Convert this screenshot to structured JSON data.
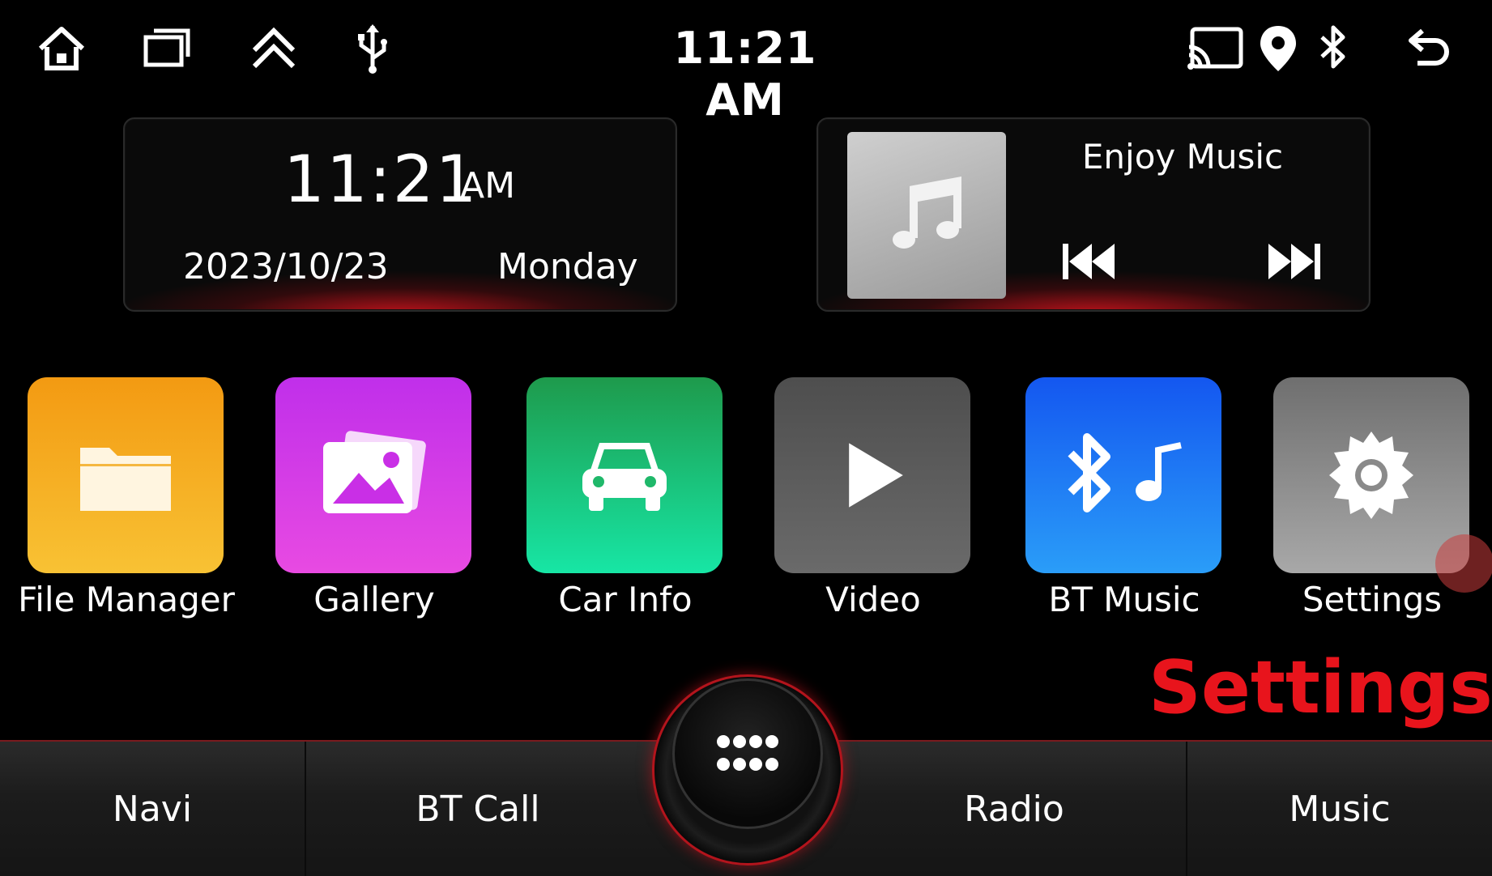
{
  "status_bar": {
    "time": "11:21 AM",
    "left_icons": [
      "home-icon",
      "recent-apps-icon",
      "double-chevron-up-icon",
      "usb-icon"
    ],
    "right_icons": [
      "cast-icon",
      "location-pin-icon",
      "bluetooth-icon",
      "back-icon"
    ]
  },
  "clock_widget": {
    "time": "11:21",
    "ampm": "AM",
    "date": "2023/10/23",
    "day": "Monday"
  },
  "music_widget": {
    "title": "Enjoy Music",
    "album_icon": "music-note-icon",
    "controls": [
      "previous-icon",
      "next-icon"
    ]
  },
  "apps": [
    {
      "label": "File Manager",
      "icon": "folder-icon",
      "color": "#f5a623"
    },
    {
      "label": "Gallery",
      "icon": "gallery-icon",
      "color": "#d52ee8"
    },
    {
      "label": "Car Info",
      "icon": "car-icon",
      "color": "#1fb86a"
    },
    {
      "label": "Video",
      "icon": "play-icon",
      "color": "#5a5a5a"
    },
    {
      "label": "BT Music",
      "icon": "bluetooth-music-icon",
      "color": "#1a6cf5"
    },
    {
      "label": "Settings",
      "icon": "gear-icon",
      "color": "#8a8a8a"
    }
  ],
  "overlay_caption": "Settings",
  "dock": {
    "items": [
      "Navi",
      "BT Call",
      "Radio",
      "Music"
    ],
    "center_icon": "app-drawer-icon"
  },
  "colors": {
    "accent_red": "#e8141c",
    "background": "#000000"
  }
}
